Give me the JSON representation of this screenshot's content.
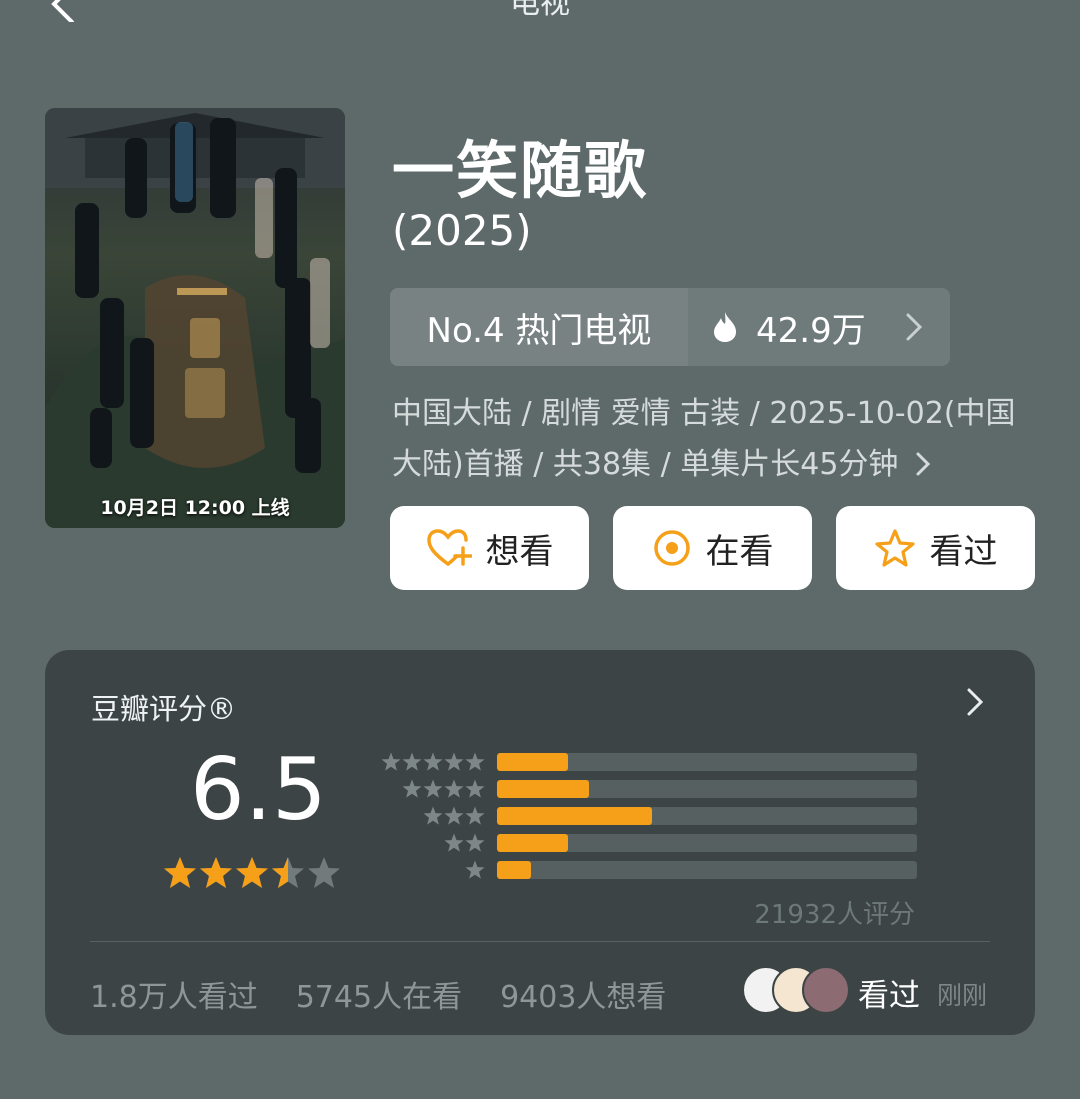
{
  "topbar": {
    "title": "电视"
  },
  "poster": {
    "caption": "10月2日 12:00 上线",
    "title_art": "一笑随歌"
  },
  "title": "一笑随歌",
  "year": "(2025)",
  "rank": {
    "label": "No.4 热门电视",
    "heat": "42.9万"
  },
  "meta": "中国大陆 / 剧情 爱情 古装 / 2025-10-02(中国大陆)首播 / 共38集 / 单集片长45分钟",
  "actions": {
    "want": "想看",
    "watching": "在看",
    "watched": "看过"
  },
  "rating": {
    "label": "豆瓣评分®",
    "score": "6.5",
    "stars_value": 3.5,
    "distribution": [
      {
        "stars": 5,
        "fraction": 0.17
      },
      {
        "stars": 4,
        "fraction": 0.22
      },
      {
        "stars": 3,
        "fraction": 0.37
      },
      {
        "stars": 2,
        "fraction": 0.17
      },
      {
        "stars": 1,
        "fraction": 0.08
      }
    ],
    "count_text": "21932人评分",
    "stats": {
      "watched": "1.8万人看过",
      "watching": "5745人在看",
      "want": "9403人想看"
    },
    "friend_action": "看过",
    "friend_time": "刚刚"
  },
  "colors": {
    "accent": "#f6a01a",
    "background": "#5e696a",
    "card": "#3c4445"
  }
}
